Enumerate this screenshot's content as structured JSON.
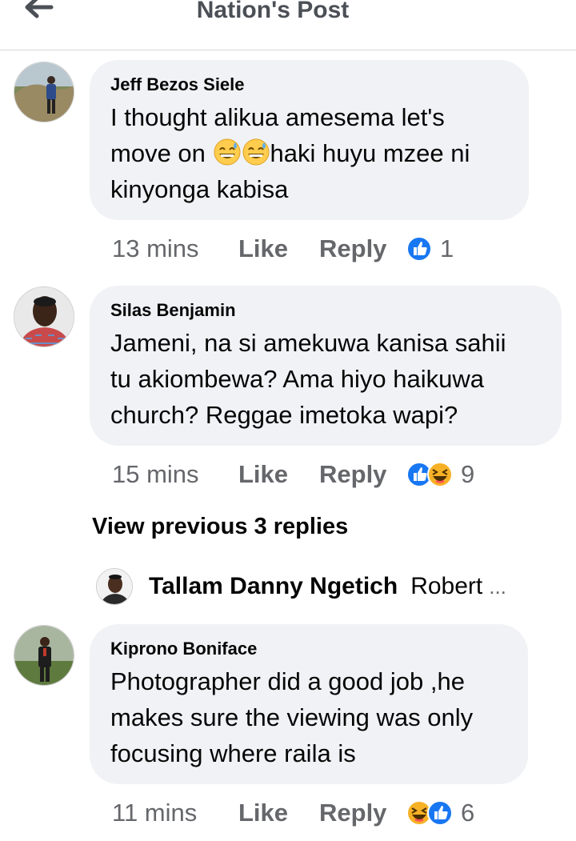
{
  "header": {
    "title": "Nation's Post",
    "back_icon": "arrow-left-icon"
  },
  "comments": [
    {
      "author": "Jeff Bezos Siele",
      "lines": [
        "I thought alikua amesema let's",
        "move on",
        "haki huyu mzee ni",
        "kinyonga kabisa"
      ],
      "inline_emoji": "grinning-sweat-emoji",
      "time": "13 mins",
      "like_label": "Like",
      "reply_label": "Reply",
      "reactions": [
        "like"
      ],
      "reaction_count": "1"
    },
    {
      "author": "Silas Benjamin",
      "lines": [
        "Jameni, na si amekuwa kanisa sahii",
        "tu akiombewa? Ama hiyo haikuwa",
        "church? Reggae imetoka wapi?"
      ],
      "time": "15 mins",
      "like_label": "Like",
      "reply_label": "Reply",
      "reactions": [
        "like",
        "haha"
      ],
      "reaction_count": "9"
    },
    {
      "author": "Kiprono Boniface",
      "lines": [
        "Photographer did a good job ,he",
        "makes sure the viewing was only",
        "focusing where raila is"
      ],
      "time": "11 mins",
      "like_label": "Like",
      "reply_label": "Reply",
      "reactions": [
        "haha",
        "like"
      ],
      "reaction_count": "6"
    }
  ],
  "thread": {
    "view_previous": "View previous 3 replies",
    "last_reply_author": "Tallam Danny Ngetich",
    "last_reply_preview": "Robert",
    "ellipsis": "..."
  },
  "colors": {
    "bubble": "#f0f2f5",
    "meta_text": "#65676b",
    "like_blue": "#1877f2",
    "haha_yellow": "#f7b125"
  }
}
